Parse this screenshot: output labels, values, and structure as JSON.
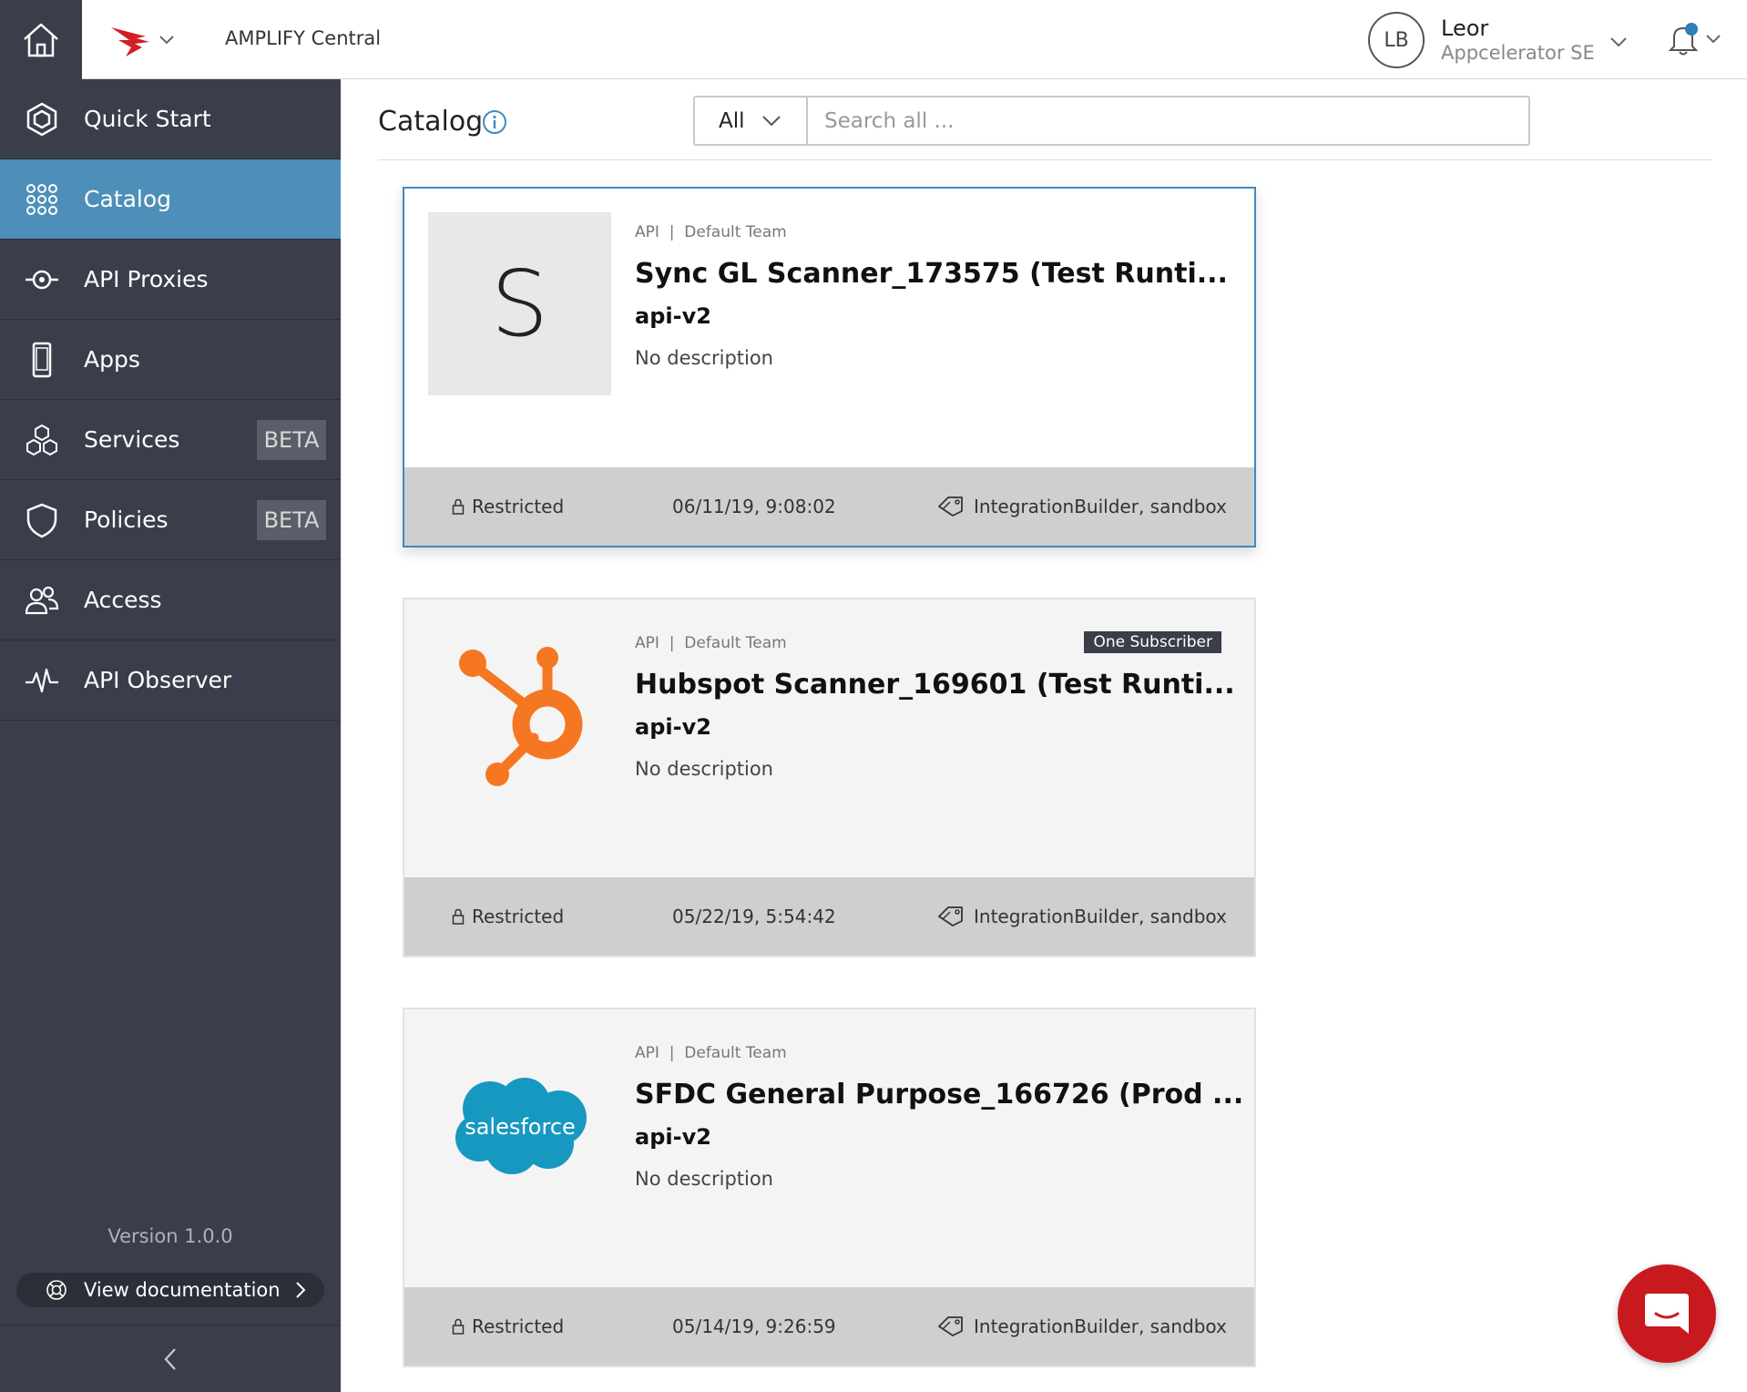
{
  "topbar": {
    "app_title": "AMPLIFY Central",
    "user": {
      "initials": "LB",
      "name": "Leor",
      "org": "Appcelerator SE"
    }
  },
  "sidebar": {
    "items": [
      {
        "label": "Quick Start",
        "icon": "hexagon-icon",
        "active": false
      },
      {
        "label": "Catalog",
        "icon": "grid-icon",
        "active": true
      },
      {
        "label": "API Proxies",
        "icon": "proxy-icon",
        "active": false
      },
      {
        "label": "Apps",
        "icon": "mobile-device-icon",
        "active": false
      },
      {
        "label": "Services",
        "icon": "cubes-icon",
        "active": false,
        "badge": "BETA"
      },
      {
        "label": "Policies",
        "icon": "shield-icon",
        "active": false,
        "badge": "BETA"
      },
      {
        "label": "Access",
        "icon": "users-icon",
        "active": false
      },
      {
        "label": "API Observer",
        "icon": "pulse-icon",
        "active": false
      }
    ],
    "version": "Version 1.0.0",
    "docs_label": "View documentation"
  },
  "catalog": {
    "title": "Catalog",
    "filter_value": "All",
    "search_placeholder": "Search all ..."
  },
  "cards": [
    {
      "thumb_letter": "S",
      "type": "API",
      "team": "Default Team",
      "title": "Sync GL Scanner_173575 (Test Runti...",
      "version": "api-v2",
      "description": "No description",
      "status": "Restricted",
      "date": "06/11/19, 9:08:02",
      "tags": "IntegrationBuilder, sandbox"
    },
    {
      "thumb_logo": "hubspot-logo",
      "type": "API",
      "team": "Default Team",
      "badge": "One Subscriber",
      "title": "Hubspot Scanner_169601 (Test Runti...",
      "version": "api-v2",
      "description": "No description",
      "status": "Restricted",
      "date": "05/22/19, 5:54:42",
      "tags": "IntegrationBuilder, sandbox"
    },
    {
      "thumb_logo": "salesforce-logo",
      "thumb_text": "salesforce",
      "type": "API",
      "team": "Default Team",
      "title": "SFDC General Purpose_166726 (Prod ...",
      "version": "api-v2",
      "description": "No description",
      "status": "Restricted",
      "date": "05/14/19, 9:26:59",
      "tags": "IntegrationBuilder, sandbox"
    }
  ],
  "colors": {
    "sidebar_bg": "#3a3e4a",
    "active_item": "#4d8fb8",
    "hubspot_orange": "#f57722",
    "salesforce_blue": "#1798c1",
    "chat_red": "#c8191f"
  }
}
